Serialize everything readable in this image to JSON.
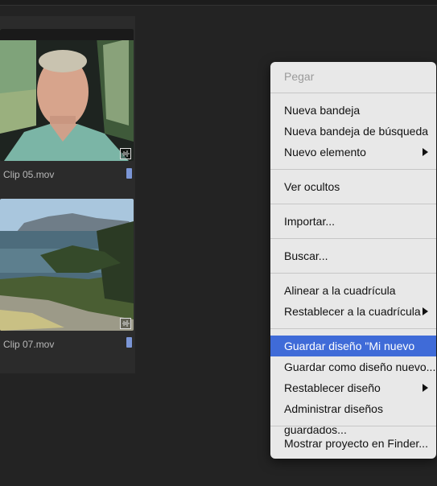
{
  "clips": [
    {
      "name": "Clip 05.mov"
    },
    {
      "name": "Clip 07.mov"
    }
  ],
  "colors": {
    "highlight": "#3f6bd8",
    "menu_bg": "#e8e8e8",
    "clip_marker": "#7b96d6"
  },
  "menu": {
    "paste": "Pegar",
    "new_bin": "Nueva bandeja",
    "new_search_bin": "Nueva bandeja de búsqueda",
    "new_item": "Nuevo elemento",
    "view_hidden": "Ver ocultos",
    "import": "Importar...",
    "find": "Buscar...",
    "align_to_grid": "Alinear a la cuadrícula",
    "reset_to_grid": "Restablecer a la cuadrícula",
    "save_layout": "Guardar diseño \"Mi nuevo diseño\"",
    "save_as_new_layout": "Guardar como diseño nuevo...",
    "reset_layout": "Restablecer diseño",
    "manage_layouts": "Administrar diseños guardados...",
    "reveal_in_finder": "Mostrar proyecto en Finder..."
  }
}
